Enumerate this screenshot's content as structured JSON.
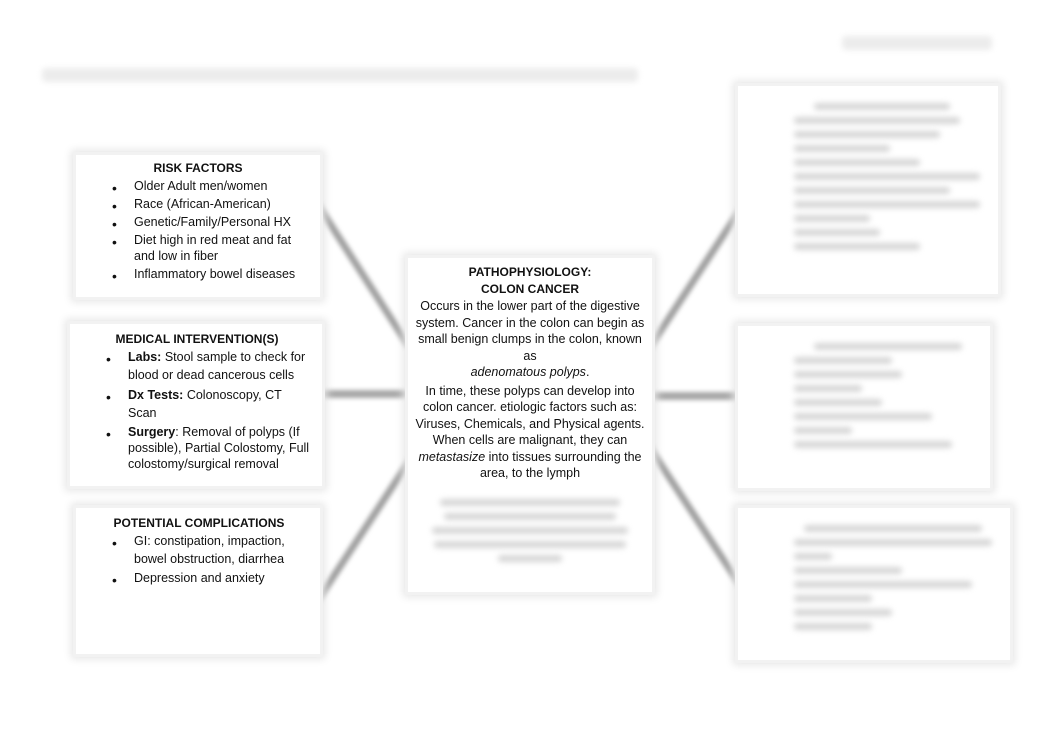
{
  "header": {
    "title_bar_redacted": true,
    "top_right_redacted": true
  },
  "left": {
    "risk_factors": {
      "title": "RISK FACTORS",
      "items": [
        "Older Adult men/women",
        "Race (African-American)",
        "Genetic/Family/Personal HX",
        "Diet high in red meat and fat and low in fiber",
        "Inflammatory bowel diseases"
      ]
    },
    "medical_interventions": {
      "title": "MEDICAL INTERVENTION(S)",
      "items": [
        {
          "label": "Labs:",
          "text": " Stool sample to check for blood or dead cancerous cells"
        },
        {
          "label": "Dx Tests:",
          "text": " Colonoscopy, CT Scan"
        },
        {
          "label": "Surgery",
          "text": ": Removal of polyps (If possible), Partial Colostomy, Full colostomy/surgical removal"
        }
      ]
    },
    "complications": {
      "title": "POTENTIAL COMPLICATIONS",
      "items": [
        "GI: constipation, impaction, bowel obstruction, diarrhea",
        "Depression and anxiety"
      ]
    }
  },
  "center": {
    "title_line1": "PATHOPHYSIOLOGY:",
    "title_line2": "COLON CANCER",
    "para1_a": "Occurs in the lower part of the digestive system. Cancer in the colon can begin as small benign clumps in the colon, known as",
    "para1_italic": "adenomatous polyps",
    "para1_end": ".",
    "para2_a": "In time, these polyps can develop into colon cancer. etiologic factors such as: Viruses, Chemicals, and Physical agents. When cells are malignant, they can ",
    "para2_italic": "metastasize",
    "para2_b": " into tissues surrounding the area, to the lymph",
    "blurred_continuation": true
  },
  "right": {
    "box1_blurred": true,
    "box2_blurred": true,
    "box3_blurred": true
  },
  "colors": {
    "arrow": "#9a9a9a",
    "box_shadow": "#e6e6e6",
    "text": "#111111"
  }
}
